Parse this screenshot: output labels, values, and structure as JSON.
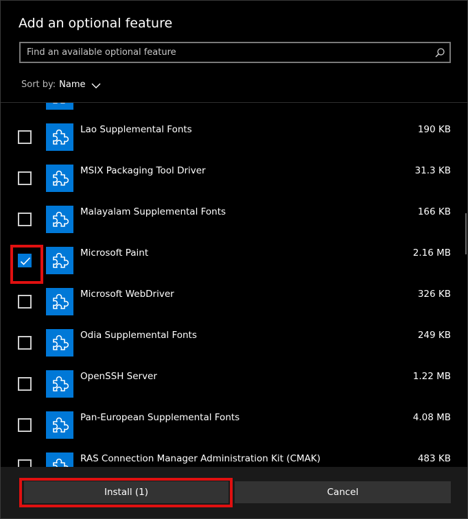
{
  "dialog": {
    "title": "Add an optional feature",
    "search_placeholder": "Find an available optional feature",
    "sort_label": "Sort by:",
    "sort_value": "Name"
  },
  "features": [
    {
      "name": "",
      "size": "",
      "checked": false
    },
    {
      "name": "Lao Supplemental Fonts",
      "size": "190 KB",
      "checked": false
    },
    {
      "name": "MSIX Packaging Tool Driver",
      "size": "31.3 KB",
      "checked": false
    },
    {
      "name": "Malayalam Supplemental Fonts",
      "size": "166 KB",
      "checked": false
    },
    {
      "name": "Microsoft Paint",
      "size": "2.16 MB",
      "checked": true
    },
    {
      "name": "Microsoft WebDriver",
      "size": "326 KB",
      "checked": false
    },
    {
      "name": "Odia Supplemental Fonts",
      "size": "249 KB",
      "checked": false
    },
    {
      "name": "OpenSSH Server",
      "size": "1.22 MB",
      "checked": false
    },
    {
      "name": "Pan-European Supplemental Fonts",
      "size": "4.08 MB",
      "checked": false
    },
    {
      "name": "RAS Connection Manager Administration Kit (CMAK)",
      "size": "483 KB",
      "checked": false
    }
  ],
  "footer": {
    "install_label": "Install (1)",
    "cancel_label": "Cancel"
  },
  "colors": {
    "accent": "#0078d7",
    "annotation": "#e01010"
  },
  "icons": {
    "search": "search-icon",
    "sort": "chevron-down-icon",
    "feature": "puzzle-piece-icon",
    "check": "checkmark-icon"
  }
}
